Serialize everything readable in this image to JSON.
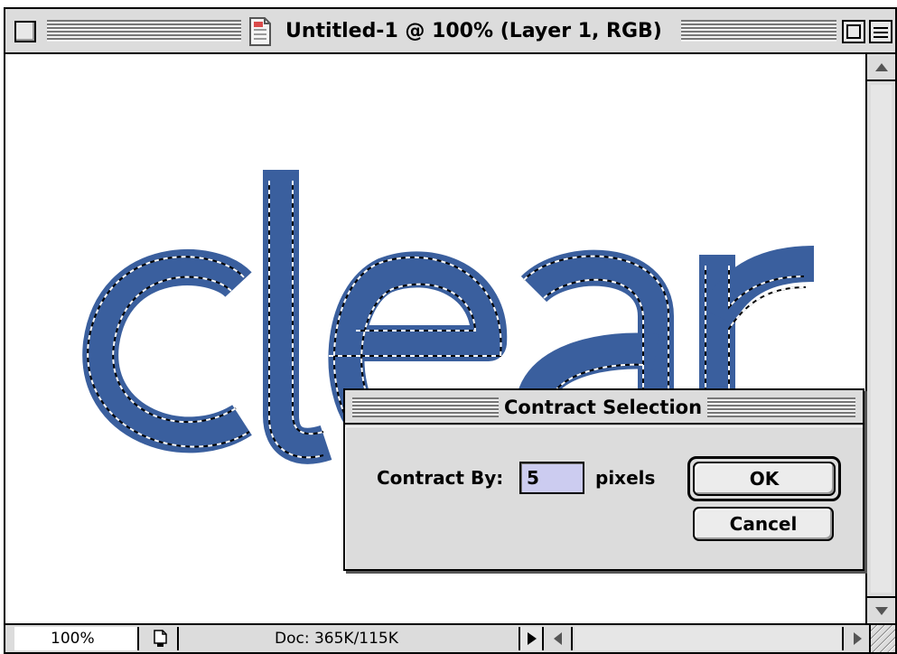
{
  "window": {
    "title": "Untitled-1 @ 100% (Layer 1, RGB)"
  },
  "canvas": {
    "text": "clear",
    "text_color": "#3a5f9e"
  },
  "status_bar": {
    "zoom": "100%",
    "doc_size": "Doc: 365K/115K"
  },
  "dialog": {
    "title": "Contract Selection",
    "contract_label": "Contract By:",
    "contract_value": "5",
    "unit_label": "pixels",
    "ok_label": "OK",
    "cancel_label": "Cancel"
  },
  "colors": {
    "chrome": "#dcdcdc",
    "field_highlight": "#ccccf0",
    "text_fill": "#3a5f9e"
  }
}
